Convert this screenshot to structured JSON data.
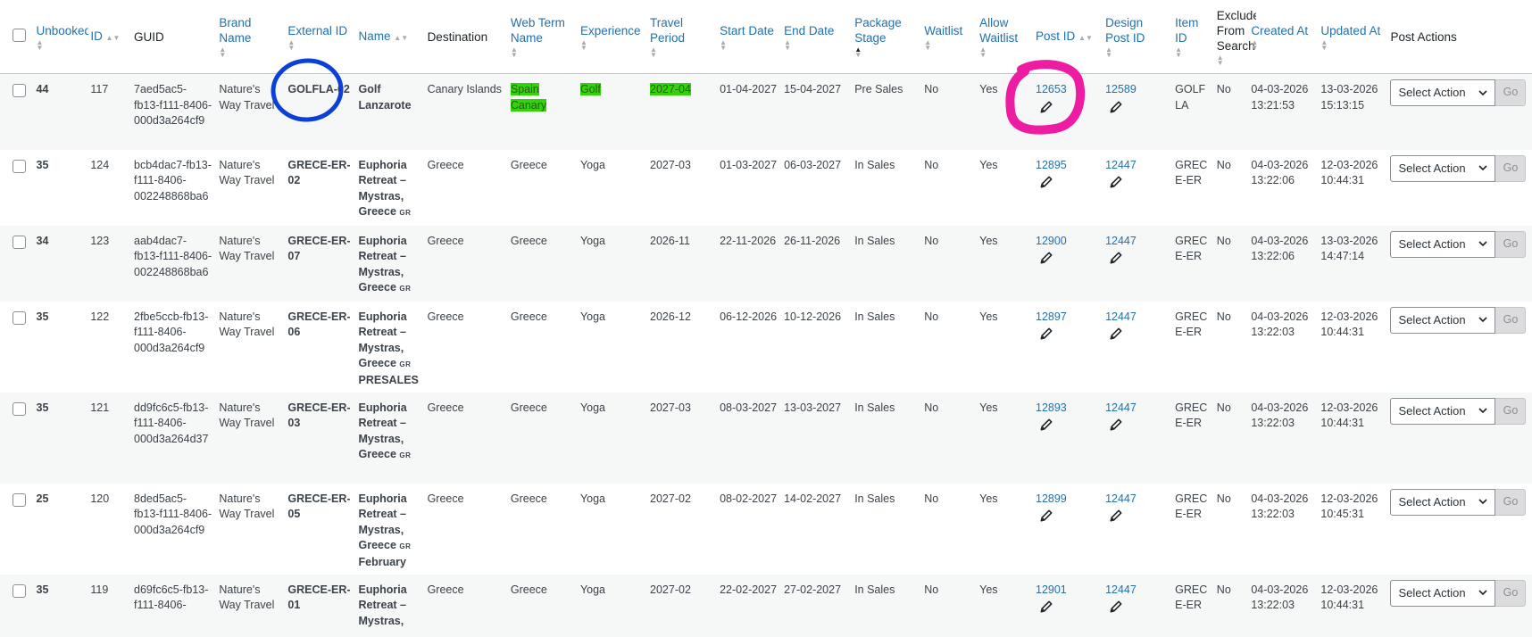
{
  "columns": {
    "unbooked": "Unbooked",
    "id": "ID",
    "guid": "GUID",
    "brand_name": "Brand Name",
    "external_id": "External ID",
    "name": "Name",
    "destination": "Destination",
    "web_term_name": "Web Term Name",
    "experience": "Experience",
    "travel_period": "Travel Period",
    "start_date": "Start Date",
    "end_date": "End Date",
    "package_stage": "Package Stage",
    "waitlist": "Waitlist",
    "allow_waitlist": "Allow Waitlist",
    "post_id": "Post ID",
    "design_post_id": "Design Post ID",
    "item_id": "Item ID",
    "exclude_from_search": "Exclude From Search",
    "created_at": "Created At",
    "updated_at": "Updated At",
    "post_actions": "Post Actions"
  },
  "action": {
    "select_label": "Select Action",
    "go_label": "Go"
  },
  "colors": {
    "link": "#2271b1",
    "highlight_green": "#35d10b",
    "annotation_blue": "#0a3fd8",
    "annotation_pink": "#ee1ba3"
  },
  "icons": {
    "pencil": "pencil-icon",
    "chevron": "chevron-down-icon",
    "sort": "sort-arrows-icon"
  },
  "rows": [
    {
      "unbooked": "44",
      "id": "117",
      "guid": "7aed5ac5-fb13-f111-8406-000d3a264cf9",
      "brand": "Nature's Way Travel",
      "external_id": "GOLFLA-02",
      "name": "Golf Lanzarote",
      "name_flag": "",
      "name_extra": "",
      "destination": "Canary Islands",
      "web_term": "Spain Canary",
      "experience": "Golf",
      "travel_period": "2027-04",
      "start_date": "01-04-2027",
      "end_date": "15-04-2027",
      "package_stage": "Pre Sales",
      "waitlist": "No",
      "allow_waitlist": "Yes",
      "post_id": "12653",
      "design_post_id": "12589",
      "item_id": "GOLF LA",
      "exclude": "No",
      "created_at": "04-03-2026 13:21:53",
      "updated_at": "13-03-2026 15:13:15"
    },
    {
      "unbooked": "35",
      "id": "124",
      "guid": "bcb4dac7-fb13-f111-8406-002248868ba6",
      "brand": "Nature's Way Travel",
      "external_id": "GRECE-ER-02",
      "name": "Euphoria Retreat – Mystras, Greece",
      "name_flag": "GR",
      "name_extra": "",
      "destination": "Greece",
      "web_term": "Greece",
      "experience": "Yoga",
      "travel_period": "2027-03",
      "start_date": "01-03-2027",
      "end_date": "06-03-2027",
      "package_stage": "In Sales",
      "waitlist": "No",
      "allow_waitlist": "Yes",
      "post_id": "12895",
      "design_post_id": "12447",
      "item_id": "GREC E-ER",
      "exclude": "No",
      "created_at": "04-03-2026 13:22:06",
      "updated_at": "12-03-2026 10:44:31"
    },
    {
      "unbooked": "34",
      "id": "123",
      "guid": "aab4dac7-fb13-f111-8406-002248868ba6",
      "brand": "Nature's Way Travel",
      "external_id": "GRECE-ER-07",
      "name": "Euphoria Retreat – Mystras, Greece",
      "name_flag": "GR",
      "name_extra": "",
      "destination": "Greece",
      "web_term": "Greece",
      "experience": "Yoga",
      "travel_period": "2026-11",
      "start_date": "22-11-2026",
      "end_date": "26-11-2026",
      "package_stage": "In Sales",
      "waitlist": "No",
      "allow_waitlist": "Yes",
      "post_id": "12900",
      "design_post_id": "12447",
      "item_id": "GREC E-ER",
      "exclude": "No",
      "created_at": "04-03-2026 13:22:06",
      "updated_at": "13-03-2026 14:47:14"
    },
    {
      "unbooked": "35",
      "id": "122",
      "guid": "2fbe5ccb-fb13-f111-8406-000d3a264cf9",
      "brand": "Nature's Way Travel",
      "external_id": "GRECE-ER-06",
      "name": "Euphoria Retreat – Mystras, Greece",
      "name_flag": "GR",
      "name_extra": "PRESALES",
      "destination": "Greece",
      "web_term": "Greece",
      "experience": "Yoga",
      "travel_period": "2026-12",
      "start_date": "06-12-2026",
      "end_date": "10-12-2026",
      "package_stage": "In Sales",
      "waitlist": "No",
      "allow_waitlist": "Yes",
      "post_id": "12897",
      "design_post_id": "12447",
      "item_id": "GREC E-ER",
      "exclude": "No",
      "created_at": "04-03-2026 13:22:03",
      "updated_at": "12-03-2026 10:44:31"
    },
    {
      "unbooked": "35",
      "id": "121",
      "guid": "dd9fc6c5-fb13-f111-8406-000d3a264d37",
      "brand": "Nature's Way Travel",
      "external_id": "GRECE-ER-03",
      "name": "Euphoria Retreat – Mystras, Greece",
      "name_flag": "GR",
      "name_extra": "",
      "destination": "Greece",
      "web_term": "Greece",
      "experience": "Yoga",
      "travel_period": "2027-03",
      "start_date": "08-03-2027",
      "end_date": "13-03-2027",
      "package_stage": "In Sales",
      "waitlist": "No",
      "allow_waitlist": "Yes",
      "post_id": "12893",
      "design_post_id": "12447",
      "item_id": "GREC E-ER",
      "exclude": "No",
      "created_at": "04-03-2026 13:22:03",
      "updated_at": "12-03-2026 10:44:31"
    },
    {
      "unbooked": "25",
      "id": "120",
      "guid": "8ded5ac5-fb13-f111-8406-000d3a264cf9",
      "brand": "Nature's Way Travel",
      "external_id": "GRECE-ER-05",
      "name": "Euphoria Retreat – Mystras, Greece",
      "name_flag": "GR",
      "name_extra": "February",
      "destination": "Greece",
      "web_term": "Greece",
      "experience": "Yoga",
      "travel_period": "2027-02",
      "start_date": "08-02-2027",
      "end_date": "14-02-2027",
      "package_stage": "In Sales",
      "waitlist": "No",
      "allow_waitlist": "Yes",
      "post_id": "12899",
      "design_post_id": "12447",
      "item_id": "GREC E-ER",
      "exclude": "No",
      "created_at": "04-03-2026 13:22:03",
      "updated_at": "12-03-2026 10:45:31"
    },
    {
      "unbooked": "35",
      "id": "119",
      "guid": "d69fc6c5-fb13-f111-8406-",
      "brand": "Nature's Way Travel",
      "external_id": "GRECE-ER-01",
      "name": "Euphoria Retreat – Mystras,",
      "name_flag": "",
      "name_extra": "",
      "destination": "Greece",
      "web_term": "Greece",
      "experience": "Yoga",
      "travel_period": "2027-02",
      "start_date": "22-02-2027",
      "end_date": "27-02-2027",
      "package_stage": "In Sales",
      "waitlist": "No",
      "allow_waitlist": "Yes",
      "post_id": "12901",
      "design_post_id": "12447",
      "item_id": "GREC E-ER",
      "exclude": "No",
      "created_at": "04-03-2026 13:22:03",
      "updated_at": "12-03-2026 10:44:31"
    }
  ]
}
